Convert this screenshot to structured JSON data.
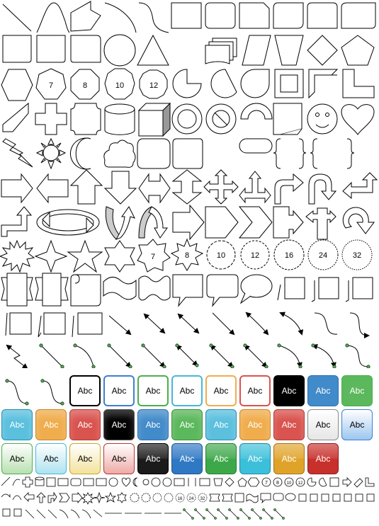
{
  "gallery": {
    "polygon_labels": [
      "7",
      "8",
      "10",
      "12"
    ],
    "star_labels": [
      "7",
      "8",
      "10",
      "12",
      "16",
      "24",
      "32"
    ],
    "style_label": "Abc",
    "mini_labels": [
      "7",
      "8",
      "10",
      "12",
      "16",
      "24",
      "32"
    ]
  },
  "theme_tiles": [
    {
      "label": "Abc",
      "style": "outline",
      "fill": "#ffffff",
      "stroke": "#000000",
      "text": "#000000"
    },
    {
      "label": "Abc",
      "style": "outline",
      "fill": "#ffffff",
      "stroke": "#3d7fd1",
      "text": "#000000"
    },
    {
      "label": "Abc",
      "style": "outline",
      "fill": "#ffffff",
      "stroke": "#4cae4c",
      "text": "#000000"
    },
    {
      "label": "Abc",
      "style": "outline",
      "fill": "#ffffff",
      "stroke": "#46b8da",
      "text": "#000000"
    },
    {
      "label": "Abc",
      "style": "outline",
      "fill": "#ffffff",
      "stroke": "#f0ad4e",
      "text": "#000000"
    },
    {
      "label": "Abc",
      "style": "outline",
      "fill": "#ffffff",
      "stroke": "#d9534f",
      "text": "#000000"
    },
    {
      "label": "Abc",
      "style": "solid",
      "fill": "#000000",
      "stroke": "#000000",
      "text": "#ffffff"
    },
    {
      "label": "Abc",
      "style": "solid",
      "fill": "#428bca",
      "stroke": "#2f6fb0",
      "text": "#ffffff"
    },
    {
      "label": "Abc",
      "style": "solid",
      "fill": "#5cb85c",
      "stroke": "#4cae4c",
      "text": "#ffffff"
    },
    {
      "label": "Abc",
      "style": "gradient",
      "fill": "#5bc0de",
      "stroke": "#2a8db0",
      "text": "#ffffff"
    },
    {
      "label": "Abc",
      "style": "gradient",
      "fill": "#f0ad4e",
      "stroke": "#c9872a",
      "text": "#ffffff"
    },
    {
      "label": "Abc",
      "style": "gradient",
      "fill": "#d9534f",
      "stroke": "#b33a36",
      "text": "#ffffff"
    },
    {
      "label": "Abc",
      "style": "gradient",
      "fill": "#000000",
      "stroke": "#555555",
      "text": "#ffffff"
    },
    {
      "label": "Abc",
      "style": "gradient",
      "fill": "#428bca",
      "stroke": "#2f6fb0",
      "text": "#ffffff"
    },
    {
      "label": "Abc",
      "style": "gradient",
      "fill": "#5cb85c",
      "stroke": "#3d8f3d",
      "text": "#ffffff"
    },
    {
      "label": "Abc",
      "style": "gradient",
      "fill": "#5bc0de",
      "stroke": "#2a8db0",
      "text": "#ffffff"
    },
    {
      "label": "Abc",
      "style": "gradient",
      "fill": "#f0ad4e",
      "stroke": "#c9872a",
      "text": "#ffffff"
    },
    {
      "label": "Abc",
      "style": "gradient",
      "fill": "#d9534f",
      "stroke": "#b33a36",
      "text": "#ffffff"
    },
    {
      "label": "Abc",
      "style": "glass",
      "fill": "#e6e6e6",
      "stroke": "#888888",
      "text": "#000000"
    },
    {
      "label": "Abc",
      "style": "glass",
      "fill": "#9cc6ee",
      "stroke": "#3d7fd1",
      "text": "#000000"
    },
    {
      "label": "Abc",
      "style": "glass",
      "fill": "#b9e0b1",
      "stroke": "#4cae4c",
      "text": "#000000"
    },
    {
      "label": "Abc",
      "style": "glass",
      "fill": "#aee3ef",
      "stroke": "#46b8da",
      "text": "#000000"
    },
    {
      "label": "Abc",
      "style": "glass",
      "fill": "#f3e39c",
      "stroke": "#c9a62a",
      "text": "#000000"
    },
    {
      "label": "Abc",
      "style": "glass",
      "fill": "#eeaaa6",
      "stroke": "#b33a36",
      "text": "#000000"
    },
    {
      "label": "Abc",
      "style": "glossy",
      "fill": "#1b1b1b",
      "stroke": "#000000",
      "text": "#ffffff"
    },
    {
      "label": "Abc",
      "style": "glossy",
      "fill": "#2f78c4",
      "stroke": "#1d5694",
      "text": "#ffffff"
    },
    {
      "label": "Abc",
      "style": "glossy",
      "fill": "#3da84a",
      "stroke": "#27802f",
      "text": "#ffffff"
    },
    {
      "label": "Abc",
      "style": "glossy",
      "fill": "#3cc0da",
      "stroke": "#1d8aa4",
      "text": "#ffffff"
    },
    {
      "label": "Abc",
      "style": "glossy",
      "fill": "#e0a32a",
      "stroke": "#a4741a",
      "text": "#ffffff"
    },
    {
      "label": "Abc",
      "style": "glossy",
      "fill": "#c8302b",
      "stroke": "#8e1f1c",
      "text": "#ffffff"
    }
  ]
}
